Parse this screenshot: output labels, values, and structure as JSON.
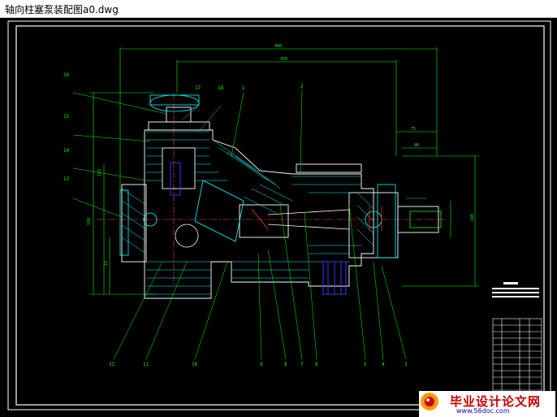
{
  "window": {
    "title": "轴向柱塞泵装配图a0.dwg"
  },
  "drawing": {
    "part_numbers": [
      "1",
      "2",
      "3",
      "4",
      "5",
      "6",
      "7",
      "8",
      "9",
      "10",
      "11",
      "12",
      "13",
      "14",
      "15",
      "16",
      "17",
      "18"
    ],
    "dimensions": {
      "d440": "440",
      "d350": "350",
      "d75": "75",
      "d40": "40",
      "d143": "143",
      "d198": "198",
      "d18": "18",
      "d166": "166"
    }
  },
  "watermark": {
    "text": "毕业设计论文网",
    "url": "www.56doc.com"
  },
  "colors": {
    "background": "#000000",
    "outline": "#ffffff",
    "dimension": "#00ff00",
    "hatch": "#00ffff",
    "part": "#0000ff",
    "accent": "#cc0000"
  }
}
